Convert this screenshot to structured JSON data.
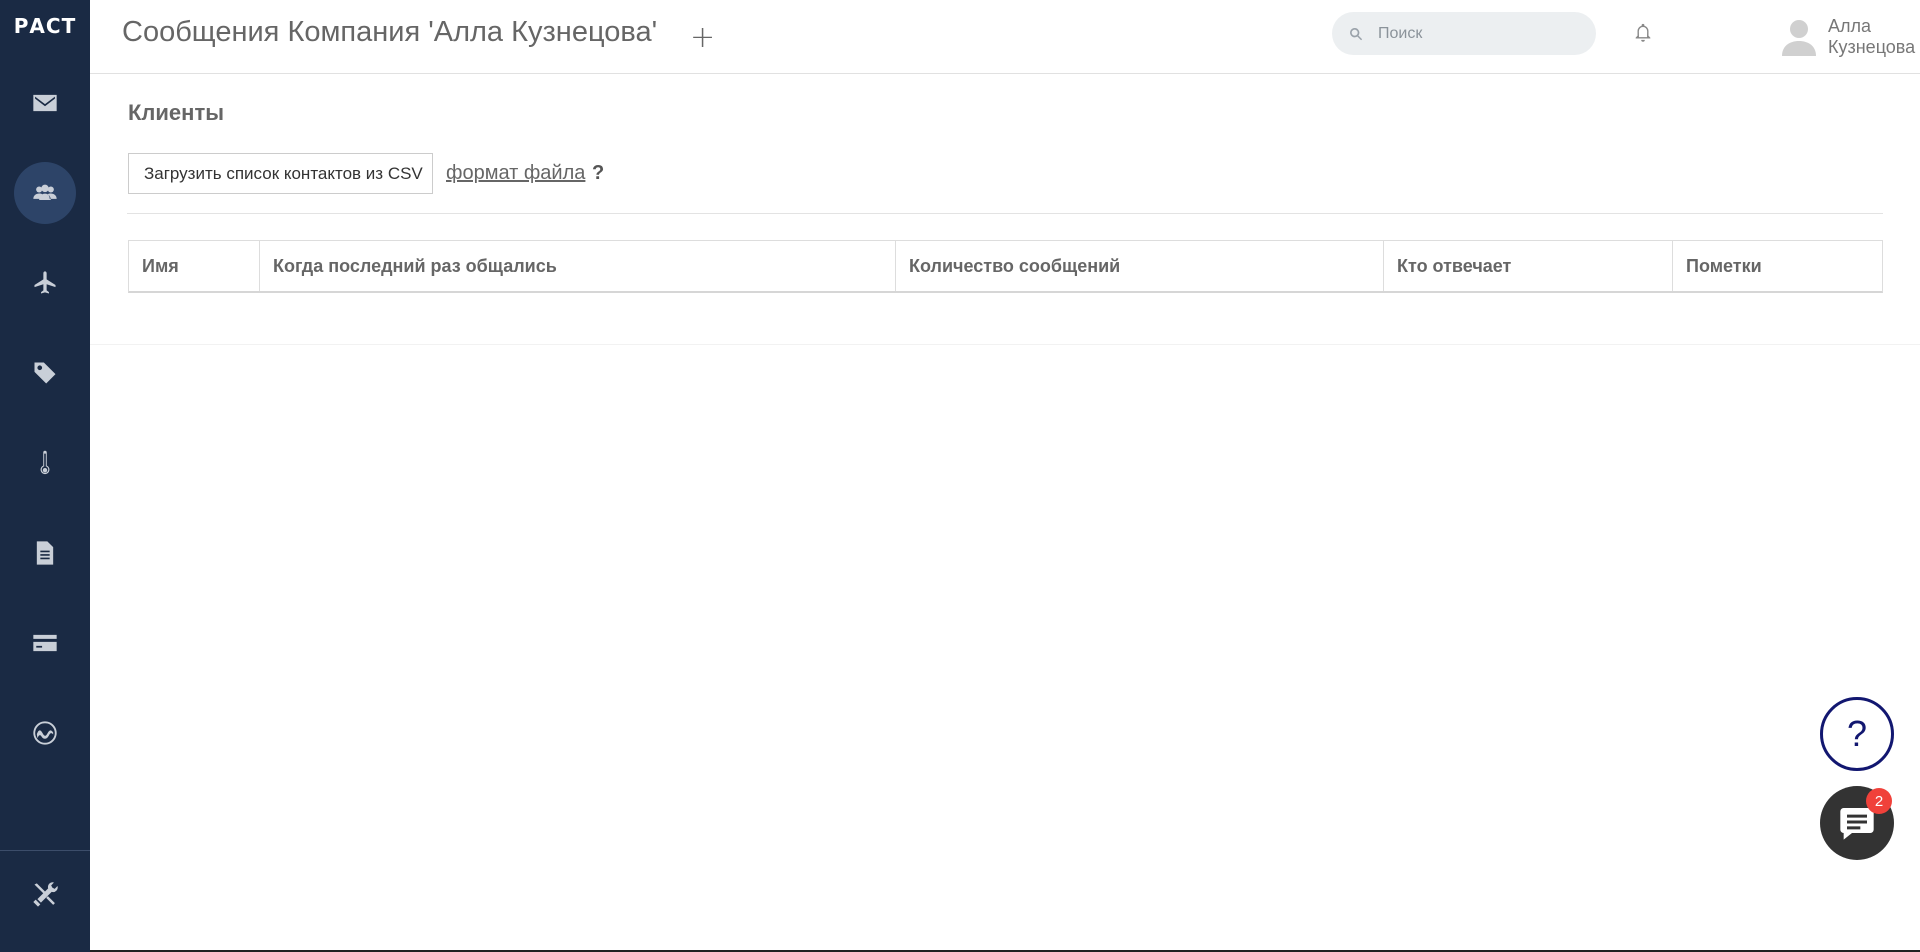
{
  "sidebar": {
    "logo": "РАСТ",
    "items": [
      {
        "icon": "mail-icon",
        "active": false
      },
      {
        "icon": "clients-icon",
        "active": true
      },
      {
        "icon": "plane-icon",
        "active": false
      },
      {
        "icon": "tags-icon",
        "active": false
      },
      {
        "icon": "thermometer-icon",
        "active": false
      },
      {
        "icon": "document-icon",
        "active": false
      },
      {
        "icon": "credit-card-icon",
        "active": false
      },
      {
        "icon": "analytics-icon",
        "active": false
      }
    ],
    "settings_icon": "tools-icon"
  },
  "header": {
    "title": "Сообщения Компания 'Алла Кузнецова'",
    "add_label": "+",
    "search_placeholder": "Поиск",
    "user_name": "Алла Кузнецова"
  },
  "main": {
    "section_title": "Клиенты",
    "upload_button": "Загрузить список контактов из CSV",
    "format_link": "формат файла",
    "format_help": "?",
    "table_headers": [
      "Имя",
      "Когда последний раз общались",
      "Количество сообщений",
      "Кто отвечает",
      "Пометки"
    ]
  },
  "widgets": {
    "help_label": "?",
    "chat_badge": "2"
  },
  "colors": {
    "sidebar_bg": "#1a2a44",
    "sidebar_active": "#2d4468",
    "help_accent": "#121770",
    "badge": "#f0413a"
  }
}
